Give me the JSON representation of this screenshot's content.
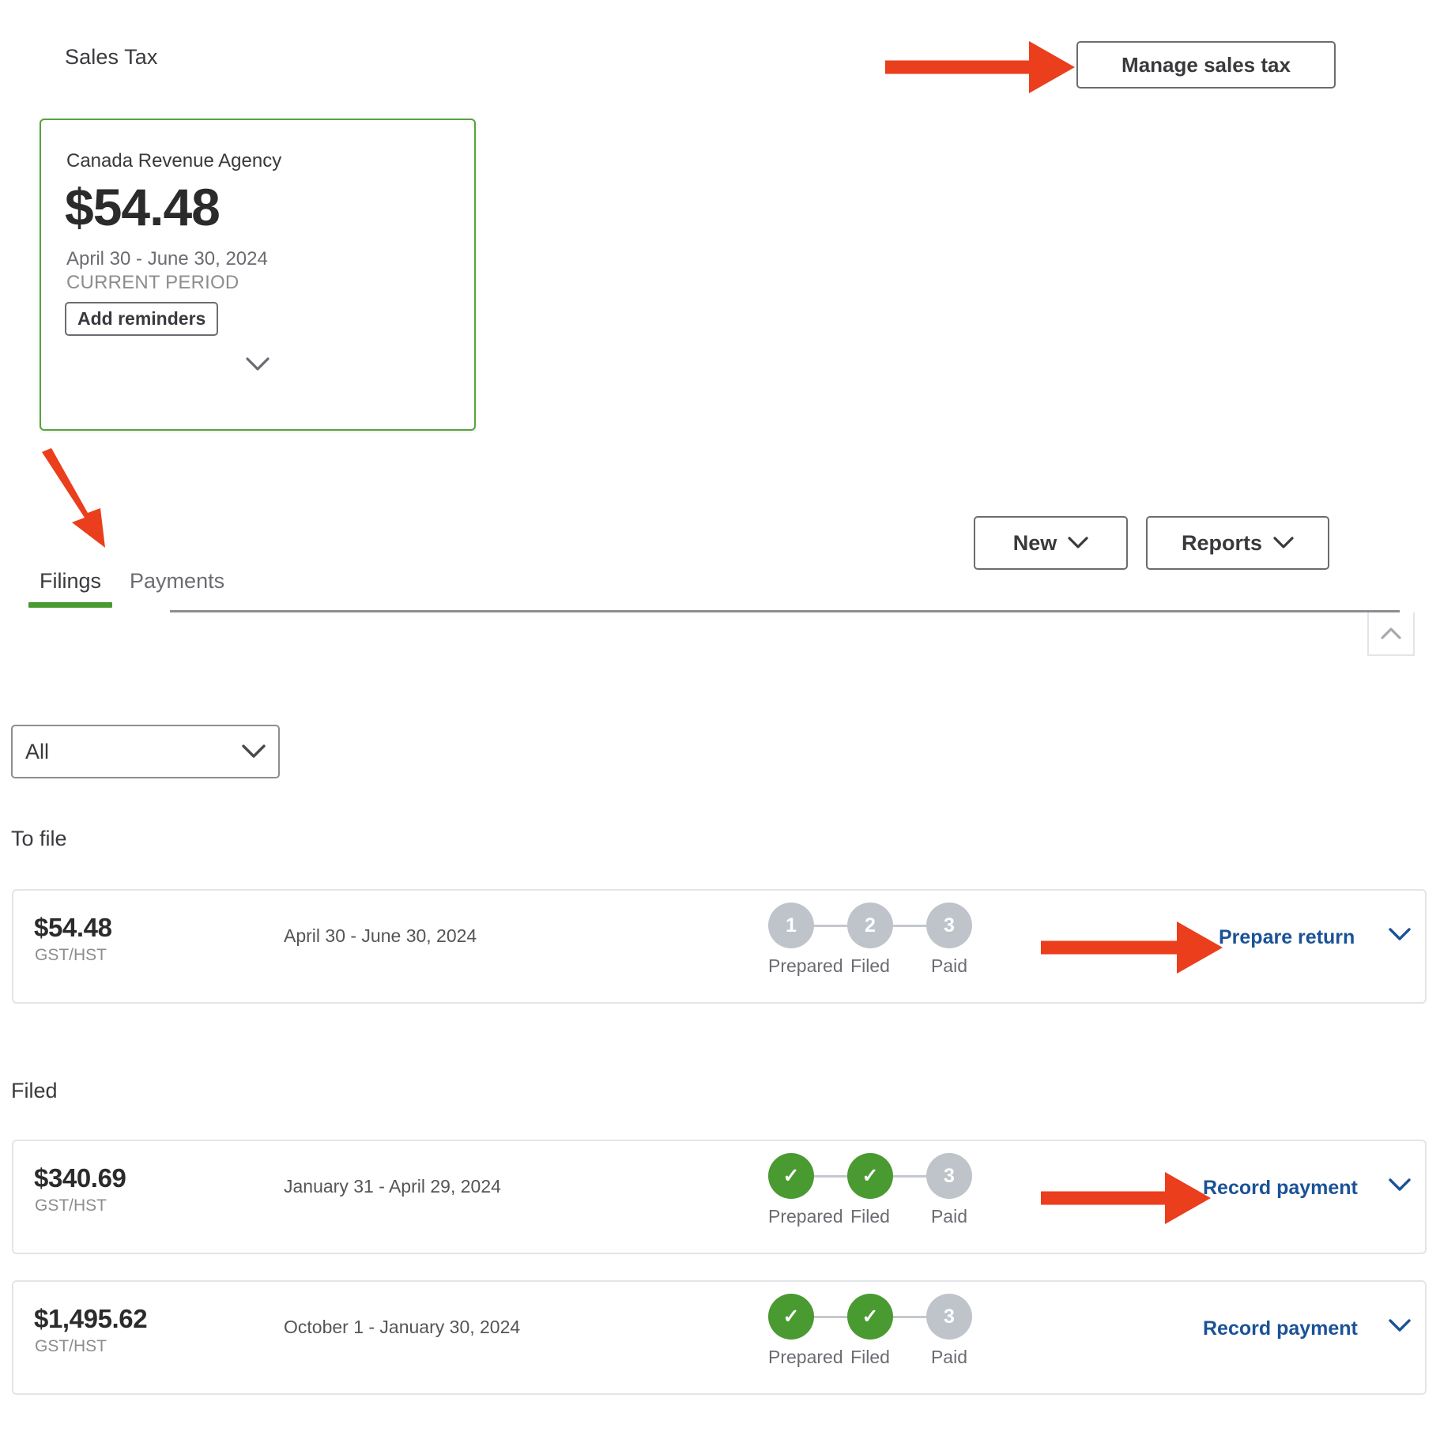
{
  "header": {
    "title": "Sales Tax",
    "manage_button": "Manage sales tax"
  },
  "summary_card": {
    "agency": "Canada Revenue Agency",
    "amount": "$54.48",
    "period": "April 30 - June 30, 2024",
    "period_status": "CURRENT PERIOD",
    "reminders_button": "Add reminders",
    "border_color": "#53a63b"
  },
  "tabs": [
    {
      "label": "Filings",
      "active": true
    },
    {
      "label": "Payments",
      "active": false
    }
  ],
  "toolbar": {
    "new_label": "New",
    "reports_label": "Reports"
  },
  "filter": {
    "selected": "All"
  },
  "sections": [
    {
      "title": "To file",
      "rows": [
        {
          "amount": "$54.48",
          "tax_type": "GST/HST",
          "period": "April 30 - June 30, 2024",
          "steps": [
            {
              "label": "Prepared",
              "marker": "1",
              "done": false
            },
            {
              "label": "Filed",
              "marker": "2",
              "done": false
            },
            {
              "label": "Paid",
              "marker": "3",
              "done": false
            }
          ],
          "action": "Prepare return",
          "has_arrow": true
        }
      ]
    },
    {
      "title": "Filed",
      "rows": [
        {
          "amount": "$340.69",
          "tax_type": "GST/HST",
          "period": "January 31 - April 29, 2024",
          "steps": [
            {
              "label": "Prepared",
              "marker": "✓",
              "done": true
            },
            {
              "label": "Filed",
              "marker": "✓",
              "done": true
            },
            {
              "label": "Paid",
              "marker": "3",
              "done": false
            }
          ],
          "action": "Record payment",
          "has_arrow": true
        },
        {
          "amount": "$1,495.62",
          "tax_type": "GST/HST",
          "period": "October 1 - January 30, 2024",
          "steps": [
            {
              "label": "Prepared",
              "marker": "✓",
              "done": true
            },
            {
              "label": "Filed",
              "marker": "✓",
              "done": true
            },
            {
              "label": "Paid",
              "marker": "3",
              "done": false
            }
          ],
          "action": "Record payment",
          "has_arrow": false
        }
      ]
    }
  ],
  "colors": {
    "accent_green": "#4a9a32",
    "link_blue": "#1b5297",
    "annotation_red": "#ea3e1c",
    "step_grey": "#bfc3ca"
  }
}
